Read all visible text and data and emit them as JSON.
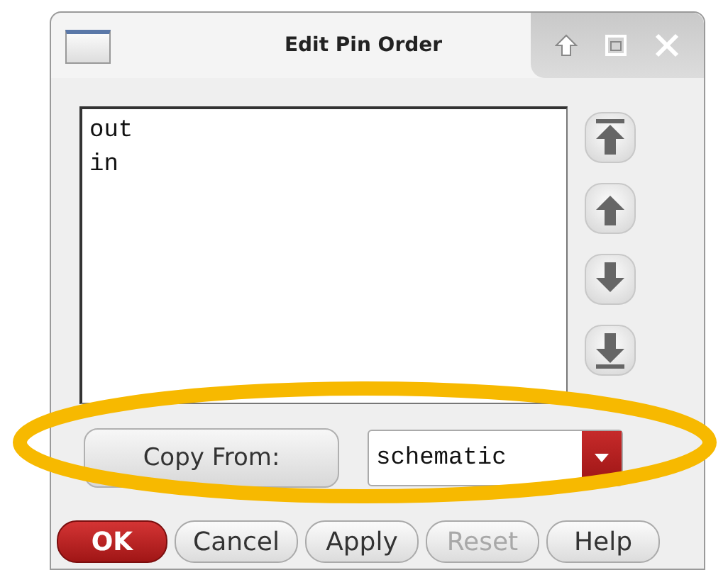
{
  "window": {
    "title": "Edit Pin Order"
  },
  "pins": [
    {
      "name": "out"
    },
    {
      "name": "in"
    }
  ],
  "copy_from": {
    "label": "Copy From:",
    "value": "schematic"
  },
  "buttons": [
    {
      "label": "OK",
      "kind": "default",
      "disabled": false
    },
    {
      "label": "Cancel",
      "kind": "normal",
      "disabled": false
    },
    {
      "label": "Apply",
      "kind": "normal",
      "disabled": false
    },
    {
      "label": "Reset",
      "kind": "normal",
      "disabled": true
    },
    {
      "label": "Help",
      "kind": "normal",
      "disabled": false
    }
  ]
}
